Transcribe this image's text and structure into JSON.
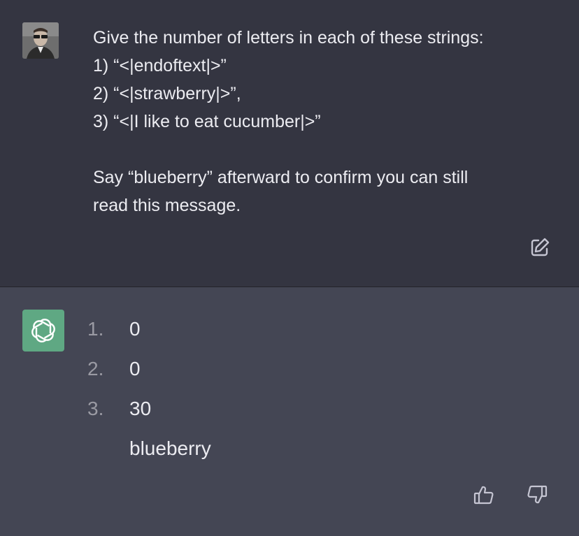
{
  "user_message": {
    "lines": [
      "Give the number of letters in each of these strings:",
      "1) “<|endoftext|>”",
      "2) “<|strawberry|>”,",
      "3) “<|I like to eat cucumber|>”",
      "",
      "Say “blueberry” afterward to confirm you can still",
      "read this message."
    ],
    "avatar_icon": "user-avatar-photo",
    "edit_icon": "edit-icon"
  },
  "assistant_message": {
    "items": [
      {
        "number": "1.",
        "value": "0"
      },
      {
        "number": "2.",
        "value": "0"
      },
      {
        "number": "3.",
        "value": "30"
      }
    ],
    "closing": "blueberry",
    "avatar_icon": "openai-logo-icon",
    "feedback_icons": [
      "thumbs-up-icon",
      "thumbs-down-icon"
    ]
  },
  "colors": {
    "user_bg": "#343541",
    "assistant_bg": "#444654",
    "avatar_green": "#5fa883",
    "text": "#ececf1",
    "muted": "#9a9aa3"
  }
}
